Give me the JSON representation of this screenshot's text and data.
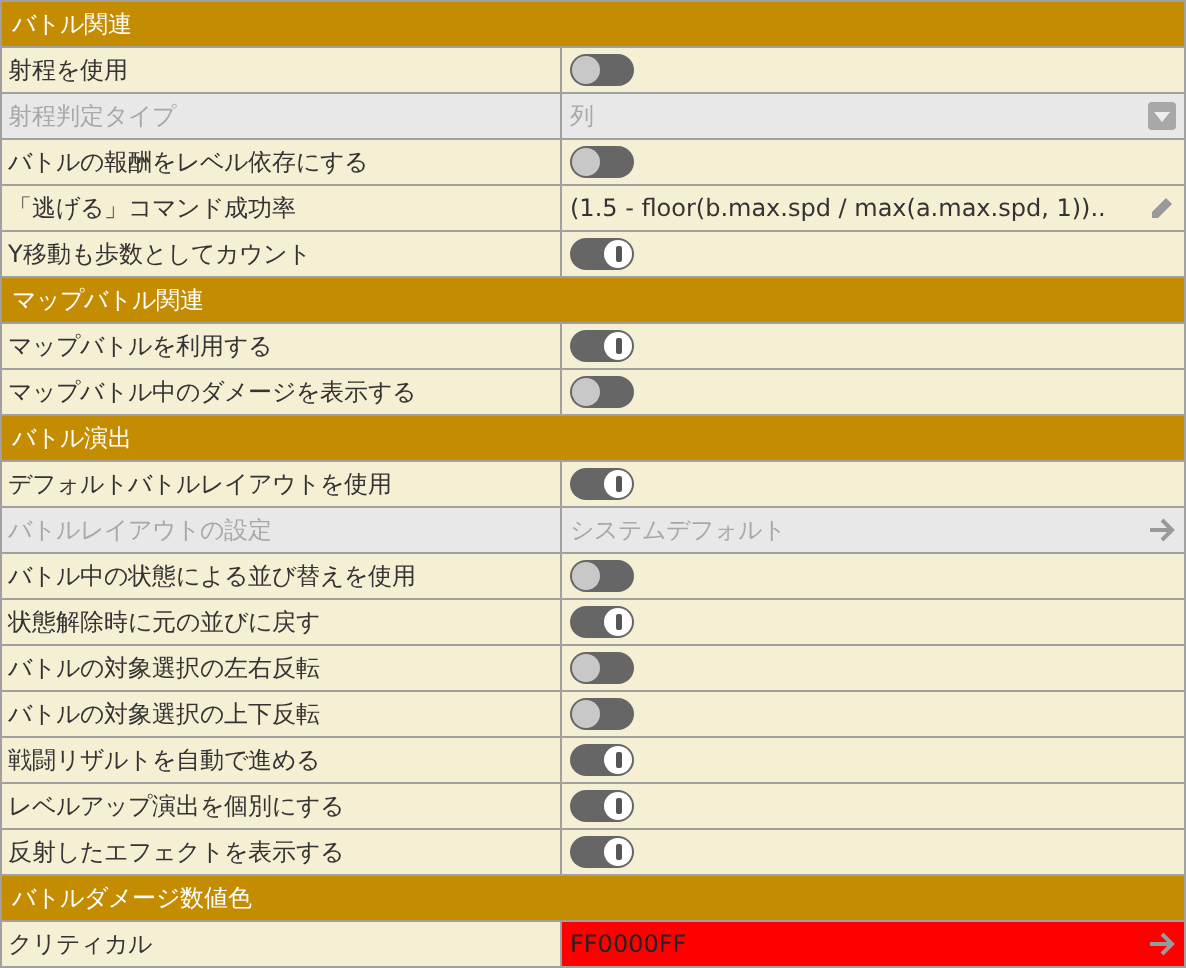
{
  "sections": [
    {
      "title": "バトル関連",
      "rows": [
        {
          "kind": "toggle",
          "label": "射程を使用",
          "on": false,
          "disabled": false
        },
        {
          "kind": "dropdown",
          "label": "射程判定タイプ",
          "value": "列",
          "disabled": true
        },
        {
          "kind": "toggle",
          "label": "バトルの報酬をレベル依存にする",
          "on": false,
          "disabled": false
        },
        {
          "kind": "formula",
          "label": "「逃げる」コマンド成功率",
          "value": "(1.5 - floor(b.max.spd / max(a.max.spd, 1))..",
          "disabled": false
        },
        {
          "kind": "toggle",
          "label": "Y移動も歩数としてカウント",
          "on": true,
          "disabled": false
        }
      ]
    },
    {
      "title": "マップバトル関連",
      "rows": [
        {
          "kind": "toggle",
          "label": "マップバトルを利用する",
          "on": true,
          "disabled": false
        },
        {
          "kind": "toggle",
          "label": "マップバトル中のダメージを表示する",
          "on": false,
          "disabled": false
        }
      ]
    },
    {
      "title": "バトル演出",
      "rows": [
        {
          "kind": "toggle",
          "label": "デフォルトバトルレイアウトを使用",
          "on": true,
          "disabled": false
        },
        {
          "kind": "link",
          "label": "バトルレイアウトの設定",
          "value": "システムデフォルト",
          "disabled": true
        },
        {
          "kind": "toggle",
          "label": "バトル中の状態による並び替えを使用",
          "on": false,
          "disabled": false
        },
        {
          "kind": "toggle",
          "label": "状態解除時に元の並びに戻す",
          "on": true,
          "disabled": false
        },
        {
          "kind": "toggle",
          "label": "バトルの対象選択の左右反転",
          "on": false,
          "disabled": false
        },
        {
          "kind": "toggle",
          "label": "バトルの対象選択の上下反転",
          "on": false,
          "disabled": false
        },
        {
          "kind": "toggle",
          "label": "戦闘リザルトを自動で進める",
          "on": true,
          "disabled": false
        },
        {
          "kind": "toggle",
          "label": "レベルアップ演出を個別にする",
          "on": true,
          "disabled": false
        },
        {
          "kind": "toggle",
          "label": "反射したエフェクトを表示する",
          "on": true,
          "disabled": false
        }
      ]
    },
    {
      "title": "バトルダメージ数値色",
      "rows": [
        {
          "kind": "color",
          "label": "クリティカル",
          "value": "FF0000FF",
          "color": "#ff0000",
          "disabled": false
        }
      ]
    }
  ]
}
